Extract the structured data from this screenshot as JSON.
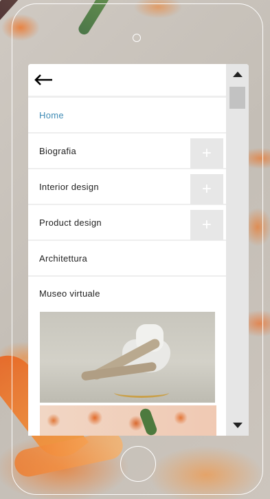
{
  "menu": {
    "items": [
      {
        "label": "Home",
        "active": true,
        "expandable": false
      },
      {
        "label": "Biografia",
        "active": false,
        "expandable": true
      },
      {
        "label": "Interior design",
        "active": false,
        "expandable": true
      },
      {
        "label": "Product design",
        "active": false,
        "expandable": true
      },
      {
        "label": "Architettura",
        "active": false,
        "expandable": false
      },
      {
        "label": "Museo virtuale",
        "active": false,
        "expandable": false
      }
    ],
    "expand_symbol": "+"
  },
  "icons": {
    "back": "arrow-left-icon",
    "scroll_up": "triangle-up-icon",
    "scroll_down": "triangle-down-icon"
  },
  "colors": {
    "active": "#3f8bb5",
    "plus_bg": "#e7e7e7",
    "divider": "#eeeeee"
  }
}
